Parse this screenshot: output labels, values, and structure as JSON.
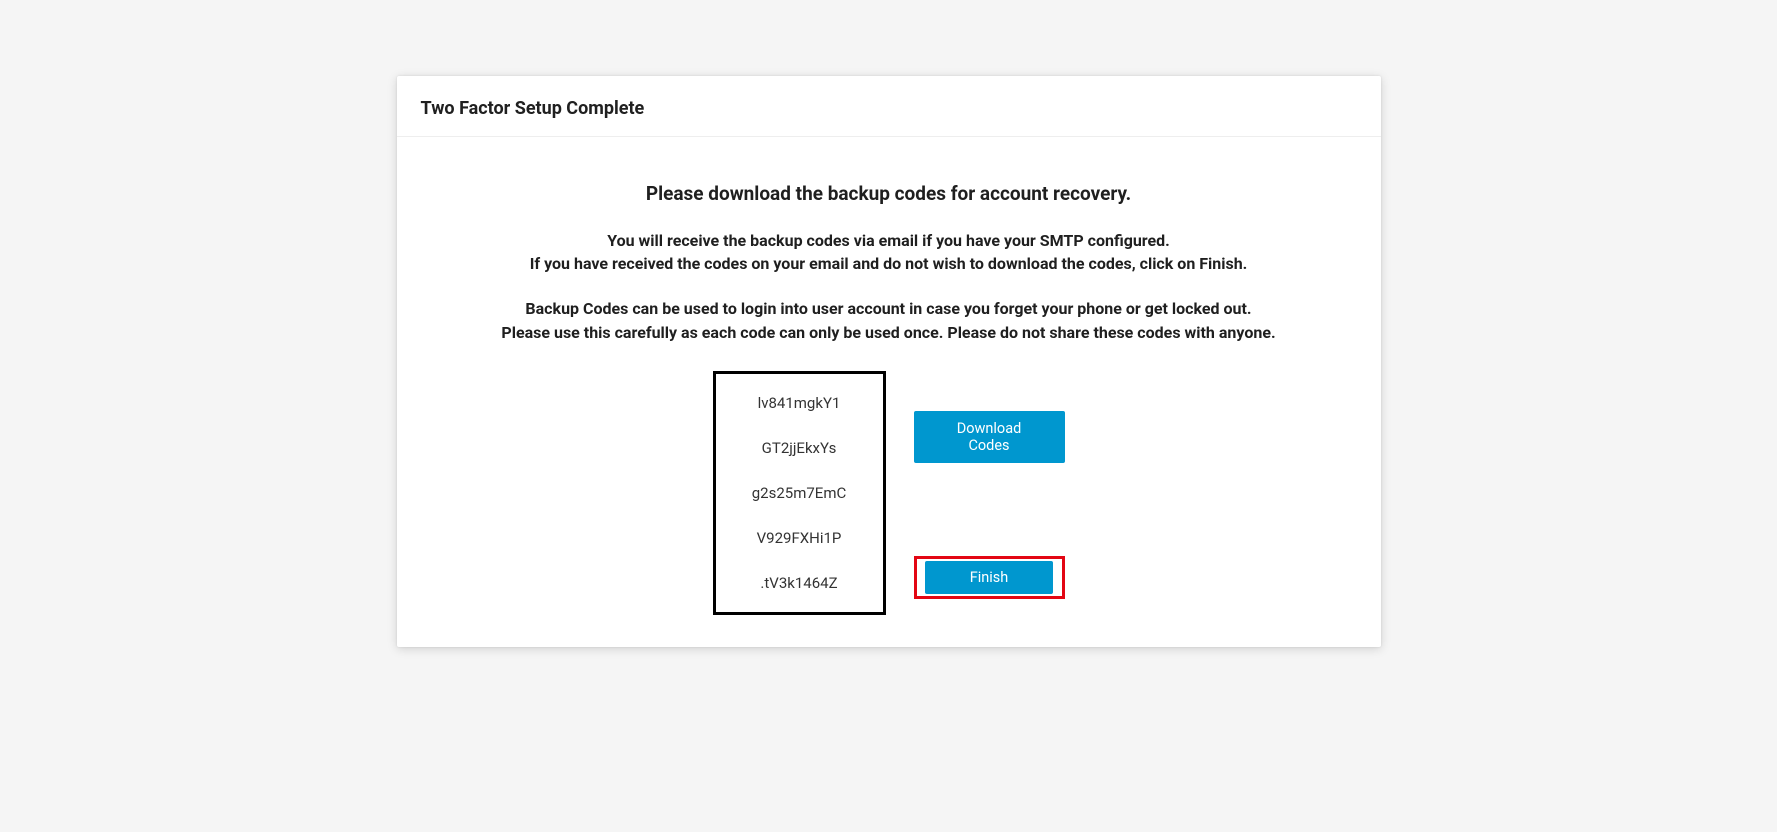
{
  "card": {
    "title": "Two Factor Setup Complete",
    "message_primary": "Please download the backup codes for account recovery.",
    "message_line1": "You will receive the backup codes via email if you have your SMTP configured.",
    "message_line2": "If you have received the codes on your email and do not wish to download the codes, click on Finish.",
    "message_line3": "Backup Codes can be used to login into user account in case you forget your phone or get locked out.",
    "message_line4": "Please use this carefully as each code can only be used once. Please do not share these codes with anyone.",
    "codes": {
      "0": "lv841mgkY1",
      "1": "GT2jjEkxYs",
      "2": "g2s25m7EmC",
      "3": "V929FXHi1P",
      "4": ".tV3k1464Z"
    },
    "download_label": "Download Codes",
    "finish_label": "Finish"
  }
}
